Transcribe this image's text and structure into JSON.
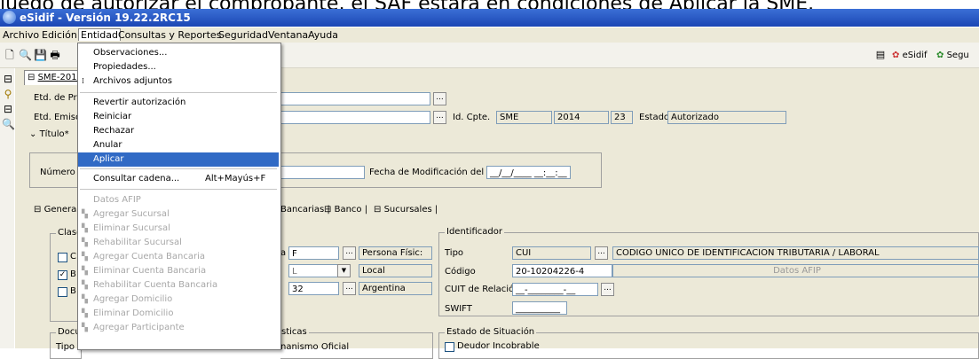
{
  "caption": "luego de autorizar el comprobante, el SAF estará en condiciones de Aplicar la SME.",
  "window": {
    "title": "eSidif - Versión 19.22.2RC15"
  },
  "menubar": [
    "Archivo",
    "Edición",
    "Entidad",
    "Consultas y Reportes",
    "Seguridad",
    "Ventana",
    "Ayuda"
  ],
  "toolbar_right": {
    "esidif": "eSidif",
    "segu": "Segu"
  },
  "doc_tab": "SME-2014-",
  "form": {
    "etd_prov_label": "Etd. de Pro",
    "etd_emisor_label": "Etd. Emisor",
    "titulo_label": "Título*",
    "idcpte_label": "Id. Cpte.",
    "idcpte_tipo": "SME",
    "idcpte_anio": "2014",
    "idcpte_num": "23",
    "estado_label": "Estado",
    "estado_value": "Autorizado",
    "numero_label": "Número E",
    "fecha_mod_label": "Fecha de Modificación del Ente",
    "fecha_mod_value": "__/__/____ __:__:__"
  },
  "tabs": [
    "General",
    "Bancarias",
    "Banco",
    "Sucursales"
  ],
  "clase_group": {
    "title": "Clase",
    "items": [
      "C",
      "B",
      "B"
    ]
  },
  "persona": {
    "label": "a",
    "code": "F",
    "desc": "Persona Físic:",
    "tipo_code": "L",
    "tipo_desc": "Local",
    "pais_code": "32",
    "pais_desc": "Argentina"
  },
  "identificador": {
    "title": "Identificador",
    "tipo_label": "Tipo",
    "tipo_value": "CUI",
    "tipo_desc": "CODIGO UNICO DE IDENTIFICACION TRIBUTARIA / LABORAL",
    "codigo_label": "Código",
    "codigo_value": "20-10204226-4",
    "datos_afip": "Datos AFIP",
    "cuit_rel_label": "CUIT de Relación",
    "cuit_rel_value": "__-________-__",
    "swift_label": "SWIFT",
    "swift_value": "__________"
  },
  "documento_group": {
    "title": "Docum",
    "tipo": "Tipo"
  },
  "sticas_group": {
    "title": "sticas",
    "org": "nanismo Oficial"
  },
  "estado_situacion": {
    "title": "Estado de Situación",
    "deudor": "Deudor Incobrable"
  },
  "entidad_menu": {
    "items": [
      {
        "label": "Observaciones...",
        "state": "normal"
      },
      {
        "label": "Propiedades...",
        "state": "normal"
      },
      {
        "label": "Archivos adjuntos",
        "state": "normal",
        "icon": "paperclip-icon"
      },
      {
        "label": "Revertir autorización",
        "state": "normal"
      },
      {
        "label": "Reiniciar",
        "state": "normal"
      },
      {
        "label": "Rechazar",
        "state": "normal"
      },
      {
        "label": "Anular",
        "state": "normal"
      },
      {
        "label": "Aplicar",
        "state": "highlighted"
      },
      {
        "label": "Consultar cadena...",
        "state": "normal",
        "shortcut": "Alt+Mayús+F"
      },
      {
        "label": "Datos AFIP",
        "state": "disabled"
      },
      {
        "label": "Agregar Sucursal",
        "state": "disabled",
        "icon": "add-row-icon"
      },
      {
        "label": "Eliminar Sucursal",
        "state": "disabled",
        "icon": "remove-row-icon"
      },
      {
        "label": "Rehabilitar Sucursal",
        "state": "disabled",
        "icon": "restore-row-icon"
      },
      {
        "label": "Agregar Cuenta Bancaria",
        "state": "disabled",
        "icon": "add-row-icon"
      },
      {
        "label": "Eliminar Cuenta Bancaria",
        "state": "disabled",
        "icon": "remove-row-icon"
      },
      {
        "label": "Rehabilitar Cuenta Bancaria",
        "state": "disabled",
        "icon": "restore-row-icon"
      },
      {
        "label": "Agregar Domicilio",
        "state": "disabled",
        "icon": "add-row-icon"
      },
      {
        "label": "Eliminar Domicilio",
        "state": "disabled",
        "icon": "remove-row-icon"
      },
      {
        "label": "Agregar Participante",
        "state": "disabled",
        "icon": "add-row-icon"
      }
    ]
  },
  "colors": {
    "title_bar": "#1b46b4",
    "highlight": "#316ac5",
    "window_bg": "#ece9d8"
  }
}
